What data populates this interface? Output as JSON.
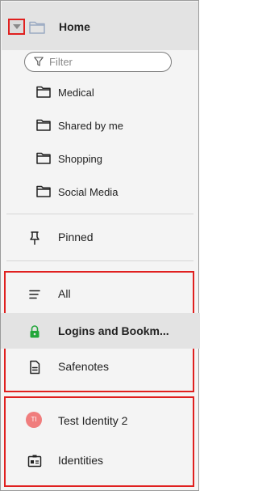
{
  "home": {
    "label": "Home"
  },
  "filter": {
    "placeholder": "Filter"
  },
  "folders": [
    {
      "label": "Medical"
    },
    {
      "label": "Shared by me"
    },
    {
      "label": "Shopping"
    },
    {
      "label": "Social Media"
    }
  ],
  "pinned": {
    "label": "Pinned"
  },
  "types": {
    "all": "All",
    "logins": "Logins and Bookm...",
    "safenotes": "Safenotes"
  },
  "identity": {
    "name": "Test Identity 2",
    "initials": "TI"
  },
  "identities": {
    "label": "Identities"
  },
  "colors": {
    "accent_red": "#e0201f",
    "lock_green": "#22a63a",
    "avatar": "#f07d7d"
  }
}
